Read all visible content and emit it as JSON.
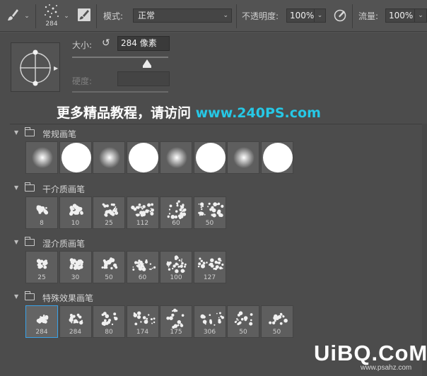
{
  "options_bar": {
    "brush_size_label": "284",
    "mode_label": "模式:",
    "mode_value": "正常",
    "opacity_label": "不透明度:",
    "opacity_value": "100%",
    "flow_label": "流量:",
    "flow_value": "100%"
  },
  "brush_panel": {
    "size_label": "大小:",
    "size_value": "284 像素",
    "size_slider_fraction": 0.78,
    "hardness_label": "硬度:",
    "hardness_value": "",
    "promo_text_cn": "更多精品教程，请访问 ",
    "promo_text_url": "www.240PS.com"
  },
  "groups": [
    {
      "name": "常规画笔",
      "brushes": [
        {
          "label": "",
          "kind": "soft"
        },
        {
          "label": "",
          "kind": "hard"
        },
        {
          "label": "",
          "kind": "soft"
        },
        {
          "label": "",
          "kind": "hard"
        },
        {
          "label": "",
          "kind": "soft"
        },
        {
          "label": "",
          "kind": "hard"
        },
        {
          "label": "",
          "kind": "soft"
        },
        {
          "label": "",
          "kind": "hard"
        }
      ]
    },
    {
      "name": "干介质画笔",
      "brushes": [
        {
          "label": "8"
        },
        {
          "label": "10"
        },
        {
          "label": "25"
        },
        {
          "label": "112"
        },
        {
          "label": "60"
        },
        {
          "label": "50"
        }
      ]
    },
    {
      "name": "湿介质画笔",
      "brushes": [
        {
          "label": "25"
        },
        {
          "label": "30"
        },
        {
          "label": "50"
        },
        {
          "label": "60"
        },
        {
          "label": "100"
        },
        {
          "label": "127"
        }
      ]
    },
    {
      "name": "特殊效果画笔",
      "brushes": [
        {
          "label": "284",
          "selected": true
        },
        {
          "label": "284"
        },
        {
          "label": "80"
        },
        {
          "label": "174"
        },
        {
          "label": "175"
        },
        {
          "label": "306"
        },
        {
          "label": "50"
        },
        {
          "label": "50"
        }
      ]
    }
  ],
  "watermark": {
    "main": "UiBQ.CoM",
    "sub": "www.psahz.com"
  },
  "colors": {
    "promo_url": "#26c8e6",
    "selection": "#39a2e8"
  }
}
